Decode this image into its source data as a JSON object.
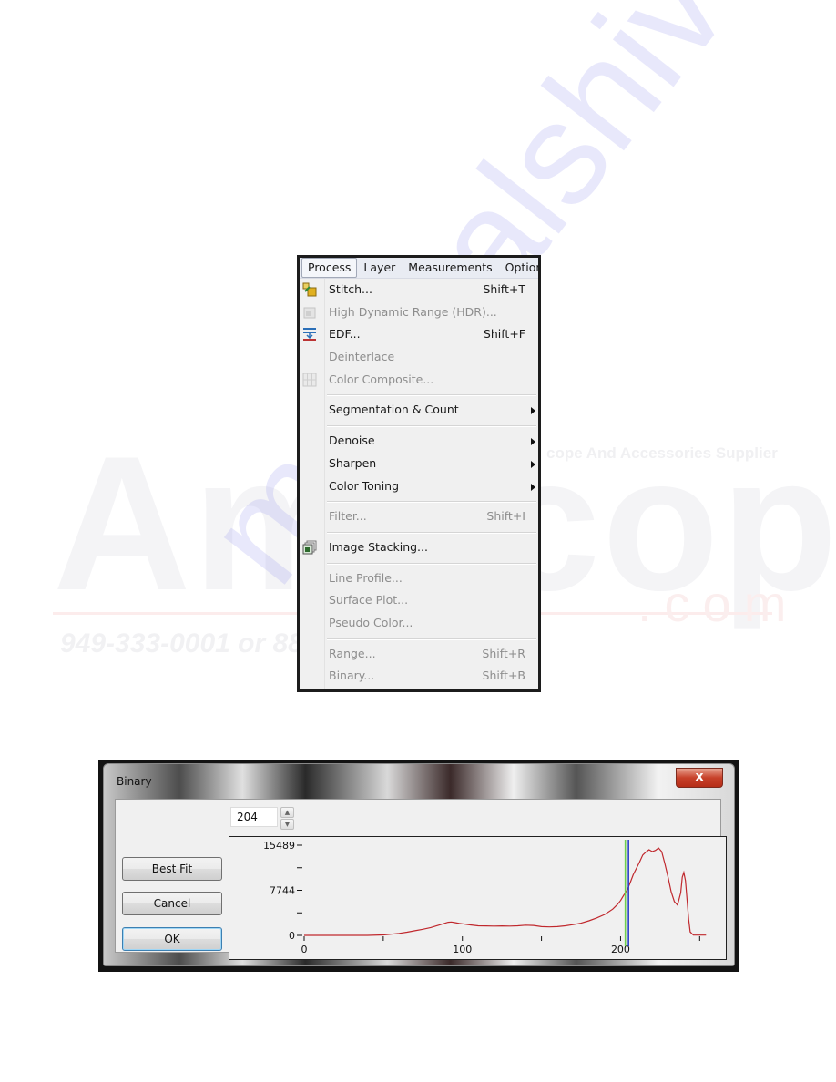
{
  "watermark": {
    "brand": "AmScope",
    "tagline": "cope And Accessories Supplier",
    "phone": "949-333-0001 or 888-   scope.com",
    "domain_suffix": ".com",
    "diagonal": "manualshive"
  },
  "menu": {
    "menubar": [
      {
        "label": "Process",
        "active": true
      },
      {
        "label": "Layer",
        "active": false
      },
      {
        "label": "Measurements",
        "active": false
      },
      {
        "label": "Options",
        "active": false
      }
    ],
    "groups": [
      [
        {
          "label": "Stitch...",
          "shortcut": "Shift+T",
          "enabled": true,
          "icon": "stitch-icon",
          "submenu": false
        },
        {
          "label": "High Dynamic Range (HDR)...",
          "shortcut": "",
          "enabled": false,
          "icon": "hdr-icon",
          "submenu": false
        },
        {
          "label": "EDF...",
          "shortcut": "Shift+F",
          "enabled": true,
          "icon": "edf-icon",
          "submenu": false
        },
        {
          "label": "Deinterlace",
          "shortcut": "",
          "enabled": false,
          "icon": "",
          "submenu": false
        },
        {
          "label": "Color Composite...",
          "shortcut": "",
          "enabled": false,
          "icon": "color-composite-icon",
          "submenu": false
        }
      ],
      [
        {
          "label": "Segmentation & Count",
          "shortcut": "",
          "enabled": true,
          "icon": "",
          "submenu": true
        }
      ],
      [
        {
          "label": "Denoise",
          "shortcut": "",
          "enabled": true,
          "icon": "",
          "submenu": true
        },
        {
          "label": "Sharpen",
          "shortcut": "",
          "enabled": true,
          "icon": "",
          "submenu": true
        },
        {
          "label": "Color Toning",
          "shortcut": "",
          "enabled": true,
          "icon": "",
          "submenu": true
        }
      ],
      [
        {
          "label": "Filter...",
          "shortcut": "Shift+I",
          "enabled": false,
          "icon": "",
          "submenu": false
        }
      ],
      [
        {
          "label": "Image Stacking...",
          "shortcut": "",
          "enabled": true,
          "icon": "image-stacking-icon",
          "submenu": false
        }
      ],
      [
        {
          "label": "Line Profile...",
          "shortcut": "",
          "enabled": false,
          "icon": "",
          "submenu": false
        },
        {
          "label": "Surface Plot...",
          "shortcut": "",
          "enabled": false,
          "icon": "",
          "submenu": false
        },
        {
          "label": "Pseudo Color...",
          "shortcut": "",
          "enabled": false,
          "icon": "",
          "submenu": false
        }
      ],
      [
        {
          "label": "Range...",
          "shortcut": "Shift+R",
          "enabled": false,
          "icon": "",
          "submenu": false
        },
        {
          "label": "Binary...",
          "shortcut": "Shift+B",
          "enabled": false,
          "icon": "",
          "submenu": false
        }
      ]
    ]
  },
  "dialog": {
    "title": "Binary",
    "close_label": "x",
    "threshold_value": "204",
    "buttons": {
      "best_fit": "Best Fit",
      "cancel": "Cancel",
      "ok": "OK"
    }
  },
  "chart_data": {
    "type": "line",
    "title": "",
    "xlabel": "",
    "ylabel": "",
    "xlim": [
      0,
      255
    ],
    "ylim": [
      0,
      15489
    ],
    "x_ticks": [
      0,
      100,
      200
    ],
    "x_minor_ticks": [
      50,
      150,
      250
    ],
    "y_ticks": [
      {
        "value": 0,
        "label": "0"
      },
      {
        "value": 3872,
        "label": ""
      },
      {
        "value": 7744,
        "label": "7744"
      },
      {
        "value": 11617,
        "label": ""
      },
      {
        "value": 15489,
        "label": "15489"
      }
    ],
    "grid": false,
    "series": [
      {
        "name": "histogram",
        "color": "#c0282d",
        "x": [
          0,
          10,
          20,
          30,
          40,
          50,
          55,
          60,
          65,
          70,
          75,
          80,
          85,
          88,
          91,
          93,
          95,
          98,
          101,
          105,
          110,
          115,
          120,
          125,
          130,
          135,
          140,
          145,
          150,
          155,
          160,
          165,
          170,
          175,
          180,
          185,
          190,
          195,
          198,
          200,
          202,
          204,
          206,
          208,
          210,
          212,
          214,
          216,
          218,
          220,
          222,
          224,
          226,
          228,
          230,
          232,
          234,
          236,
          238,
          239,
          240,
          241,
          242,
          243,
          244,
          246,
          250,
          254
        ],
        "y": [
          0,
          0,
          0,
          0,
          0,
          80,
          200,
          350,
          550,
          800,
          1050,
          1350,
          1750,
          2000,
          2250,
          2300,
          2200,
          2050,
          1950,
          1800,
          1650,
          1620,
          1600,
          1620,
          1600,
          1650,
          1750,
          1700,
          1500,
          1450,
          1500,
          1650,
          1850,
          2100,
          2500,
          3000,
          3600,
          4500,
          5300,
          6000,
          6900,
          7700,
          9000,
          10400,
          11500,
          12600,
          13800,
          14300,
          14700,
          14400,
          14600,
          15000,
          14400,
          12300,
          10000,
          7500,
          5800,
          5200,
          7300,
          10000,
          10800,
          9400,
          6200,
          2800,
          600,
          50,
          50,
          50
        ]
      }
    ],
    "markers": [
      {
        "name": "threshold-low",
        "x": 203,
        "color": "#6fcf4f"
      },
      {
        "name": "threshold-high",
        "x": 205,
        "color": "#2a3fc8"
      }
    ]
  }
}
